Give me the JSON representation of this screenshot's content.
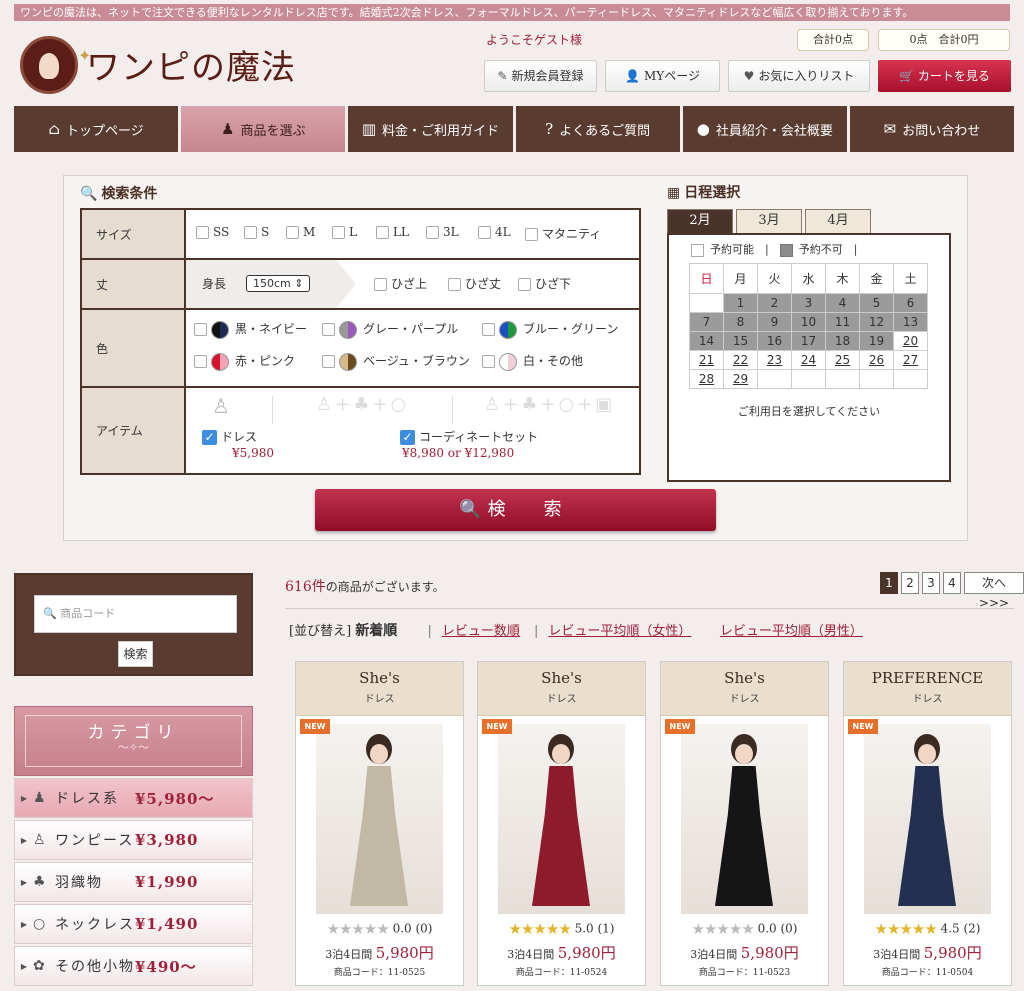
{
  "topbar": {
    "text": "ワンピの魔法は、ネットで注文できる便利なレンタルドレス店です。結婚式2次会ドレス、フォーマルドレス、パーティードレス、マタニティドレスなど幅広く取り揃えております。"
  },
  "logo": {
    "text": "ワンピの魔法"
  },
  "header": {
    "welcome": "ようこそゲスト様",
    "points": "合計0点",
    "total": "0点　合計0円",
    "register": "新規会員登録",
    "mypage": "MYページ",
    "favorites": "お気に入りリスト",
    "cart": "カートを見る"
  },
  "nav": [
    {
      "label": "トップページ",
      "icon": "home-icon"
    },
    {
      "label": "商品を選ぶ",
      "icon": "dress-icon"
    },
    {
      "label": "料金・ご利用ガイド",
      "icon": "book-icon"
    },
    {
      "label": "よくあるご質問",
      "icon": "question-icon"
    },
    {
      "label": "社員紹介・会社概要",
      "icon": "person-icon"
    },
    {
      "label": "お問い合わせ",
      "icon": "mail-icon"
    }
  ],
  "search": {
    "title": "検索条件",
    "size": {
      "label": "サイズ",
      "options": [
        "SS",
        "S",
        "M",
        "L",
        "LL",
        "3L",
        "4L",
        "マタニティ"
      ]
    },
    "length": {
      "label": "丈",
      "height_label": "身長",
      "height_value": "150cm",
      "options": [
        "ひざ上",
        "ひざ丈",
        "ひざ下"
      ]
    },
    "color": {
      "label": "色",
      "options": [
        {
          "name": "黒・ネイビー",
          "c1": "#111111",
          "c2": "#1c2a55"
        },
        {
          "name": "グレー・パープル",
          "c1": "#999999",
          "c2": "#9b5bb8"
        },
        {
          "name": "ブルー・グリーン",
          "c1": "#1f4fc4",
          "c2": "#1a9a3a"
        },
        {
          "name": "赤・ピンク",
          "c1": "#d8142c",
          "c2": "#f2a5b5"
        },
        {
          "name": "ベージュ・ブラウン",
          "c1": "#d6b98a",
          "c2": "#6b4a1f"
        },
        {
          "name": "白・その他",
          "c1": "#ffffff",
          "c2": "#f2d0d8"
        }
      ]
    },
    "item": {
      "label": "アイテム",
      "dress": "ドレス",
      "dress_price": "¥5,980",
      "coord": "コーディネートセット",
      "coord_price": "¥8,980 or ¥12,980"
    },
    "button": "検　索"
  },
  "calendar": {
    "title": "日程選択",
    "months": [
      "2月",
      "3月",
      "4月"
    ],
    "legend_available": "予約可能",
    "legend_unavailable": "予約不可",
    "weekdays": [
      "日",
      "月",
      "火",
      "水",
      "木",
      "金",
      "土"
    ],
    "note": "ご利用日を選択してください"
  },
  "codebox": {
    "placeholder": "商品コード",
    "button": "検索"
  },
  "category": {
    "title": "カテゴリ",
    "items": [
      {
        "name": "ドレス系",
        "price": "¥5,980〜",
        "icon": "dress-icon"
      },
      {
        "name": "ワンピース",
        "price": "¥3,980",
        "icon": "onepiece-icon"
      },
      {
        "name": "羽織物",
        "price": "¥1,990",
        "icon": "jacket-icon"
      },
      {
        "name": "ネックレス",
        "price": "¥1,490",
        "icon": "necklace-icon"
      },
      {
        "name": "その他小物",
        "price": "¥490〜",
        "icon": "flower-icon"
      }
    ]
  },
  "results": {
    "count": "616件",
    "count_suffix": "の商品がございます。"
  },
  "pager": {
    "pages": [
      "1",
      "2",
      "3",
      "4"
    ],
    "next": "次へ>>>"
  },
  "sort": {
    "label": "[並び替え]",
    "current": "新着順",
    "options": [
      "レビュー数順",
      "レビュー平均順（女性）",
      "レビュー平均順（男性）"
    ]
  },
  "products": [
    {
      "brand": "She's",
      "type": "ドレス",
      "badge": "NEW",
      "rating": 0,
      "rating_text": "0.0 (0)",
      "period": "3泊4日間",
      "price": "5,980円",
      "code": "商品コード：11-0525",
      "color": "#c2b9a4"
    },
    {
      "brand": "She's",
      "type": "ドレス",
      "badge": "NEW",
      "rating": 5,
      "rating_text": "5.0 (1)",
      "period": "3泊4日間",
      "price": "5,980円",
      "code": "商品コード：11-0524",
      "color": "#8f1a2c"
    },
    {
      "brand": "She's",
      "type": "ドレス",
      "badge": "NEW",
      "rating": 0,
      "rating_text": "0.0 (0)",
      "period": "3泊4日間",
      "price": "5,980円",
      "code": "商品コード：11-0523",
      "color": "#151515"
    },
    {
      "brand": "PREFERENCE",
      "type": "ドレス",
      "badge": "NEW",
      "rating": 4.5,
      "rating_text": "4.5 (2)",
      "period": "3泊4日間",
      "price": "5,980円",
      "code": "商品コード：11-0504",
      "color": "#24304f"
    }
  ]
}
